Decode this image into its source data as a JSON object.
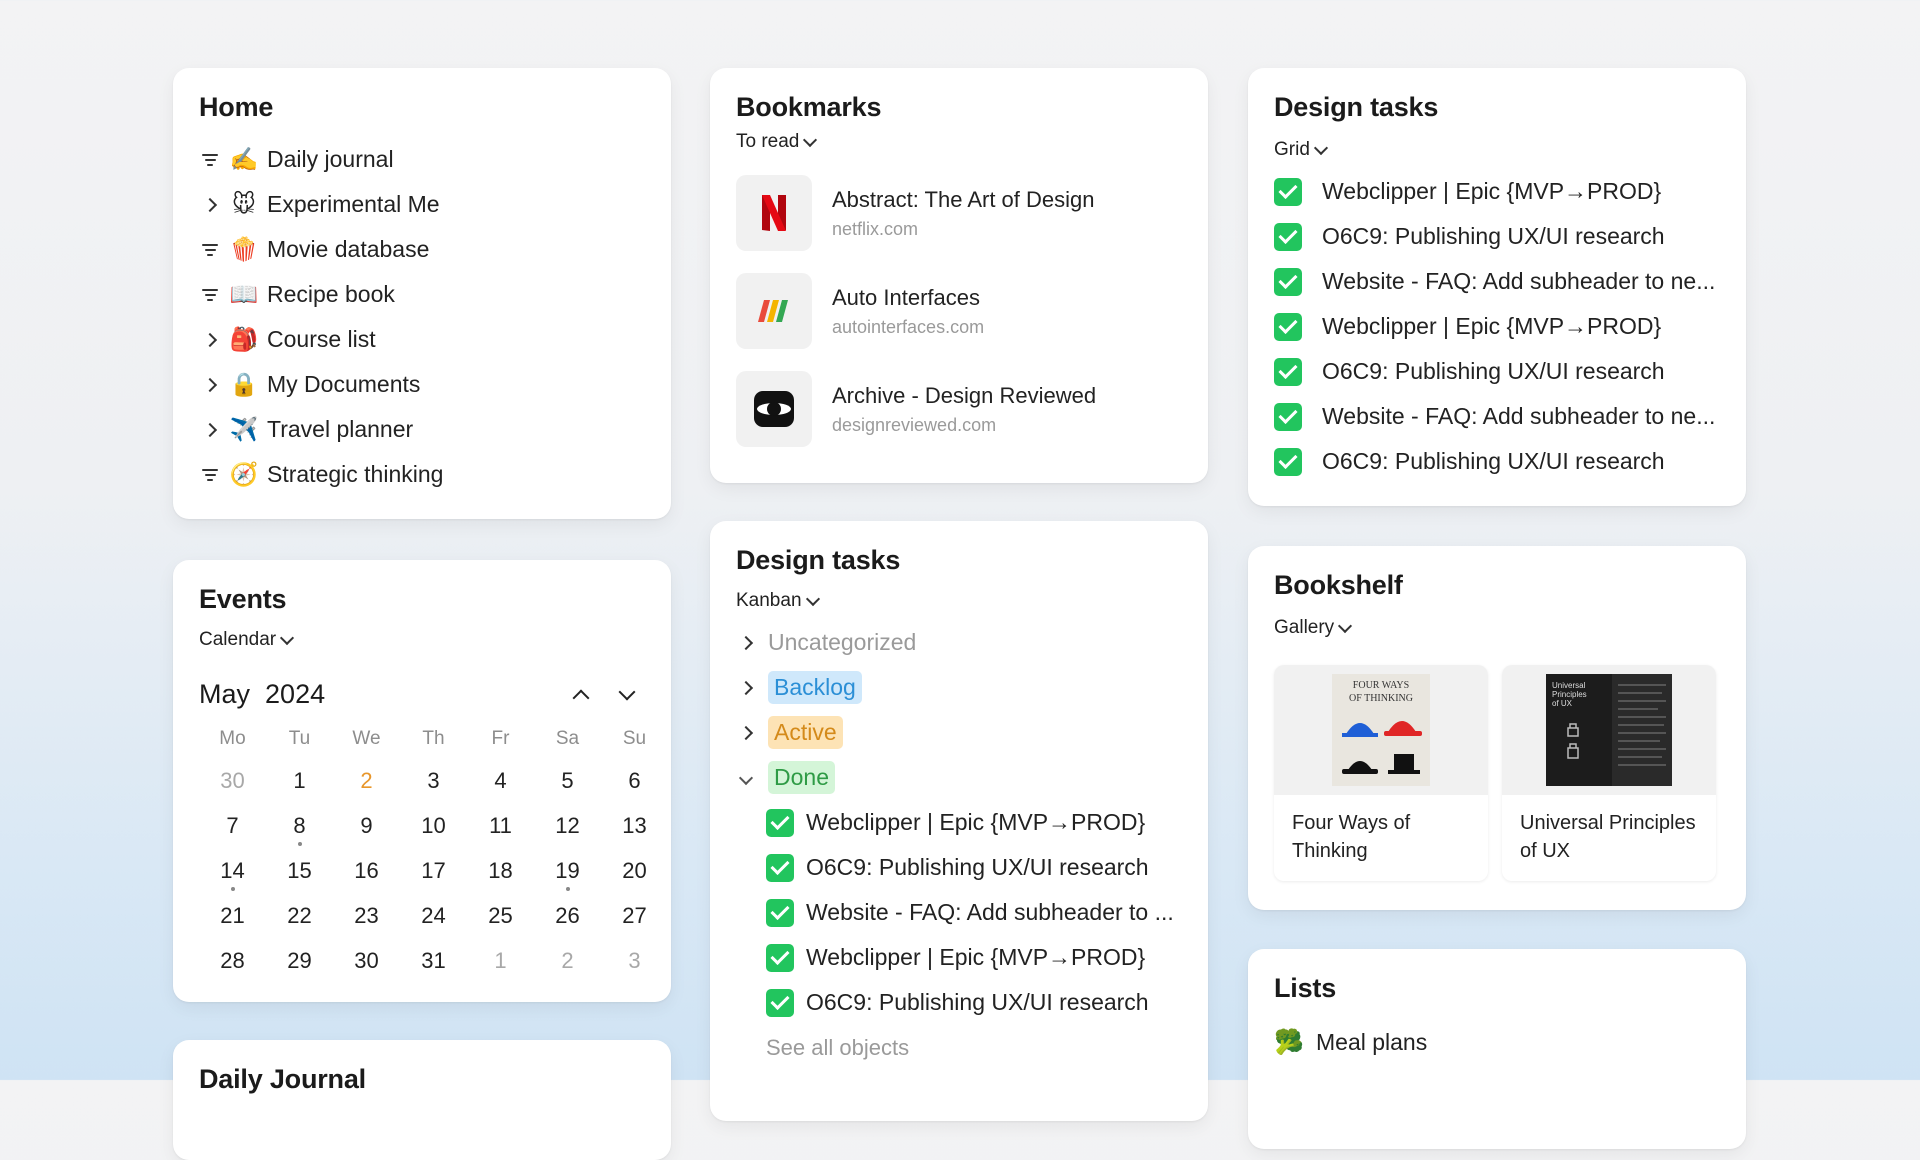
{
  "home": {
    "title": "Home",
    "items": [
      {
        "lead": "filter",
        "emoji": "✍️",
        "icon": "writing-hand-icon",
        "label": "Daily journal"
      },
      {
        "lead": "chevron",
        "emoji": "🐭",
        "icon": "mouse-icon",
        "label": "Experimental Me"
      },
      {
        "lead": "filter",
        "emoji": "🍿",
        "icon": "popcorn-icon",
        "label": "Movie database"
      },
      {
        "lead": "filter",
        "emoji": "📖",
        "icon": "book-icon",
        "label": "Recipe book"
      },
      {
        "lead": "chevron",
        "emoji": "🎒",
        "icon": "backpack-icon",
        "label": "Course list"
      },
      {
        "lead": "chevron",
        "emoji": "🔒",
        "icon": "lock-icon",
        "label": "My Documents"
      },
      {
        "lead": "chevron",
        "emoji": "✈️",
        "icon": "airplane-icon",
        "label": "Travel planner"
      },
      {
        "lead": "filter",
        "emoji": "🧭",
        "icon": "compass-icon",
        "label": "Strategic thinking"
      }
    ]
  },
  "bookmarks": {
    "title": "Bookmarks",
    "view": "To read",
    "items": [
      {
        "title": "Abstract: The Art of Design",
        "url": "netflix.com",
        "icon": "netflix-logo-icon"
      },
      {
        "title": "Auto Interfaces",
        "url": "autointerfaces.com",
        "icon": "auto-interfaces-logo-icon"
      },
      {
        "title": "Archive - Design Reviewed",
        "url": "designreviewed.com",
        "icon": "design-reviewed-logo-icon"
      }
    ]
  },
  "design_tasks_grid": {
    "title": "Design tasks",
    "view": "Grid",
    "tasks": [
      "Webclipper | Epic {MVP→PROD}",
      "O6C9: Publishing UX/UI research",
      "Website - FAQ: Add subheader to ne...",
      "Webclipper | Epic {MVP→PROD}",
      "O6C9: Publishing UX/UI research",
      "Website - FAQ: Add subheader to ne...",
      "O6C9: Publishing UX/UI research"
    ]
  },
  "events": {
    "title": "Events",
    "view": "Calendar",
    "month": "May",
    "year": "2024",
    "weekdays": [
      "Mo",
      "Tu",
      "We",
      "Th",
      "Fr",
      "Sa",
      "Su"
    ],
    "days": [
      {
        "d": "30",
        "muted": true
      },
      {
        "d": "1"
      },
      {
        "d": "2",
        "today": true
      },
      {
        "d": "3"
      },
      {
        "d": "4"
      },
      {
        "d": "5"
      },
      {
        "d": "6"
      },
      {
        "d": "7"
      },
      {
        "d": "8",
        "dot": true
      },
      {
        "d": "9"
      },
      {
        "d": "10"
      },
      {
        "d": "11"
      },
      {
        "d": "12"
      },
      {
        "d": "13"
      },
      {
        "d": "14",
        "dot": true
      },
      {
        "d": "15"
      },
      {
        "d": "16"
      },
      {
        "d": "17"
      },
      {
        "d": "18"
      },
      {
        "d": "19",
        "dot": true
      },
      {
        "d": "20"
      },
      {
        "d": "21"
      },
      {
        "d": "22"
      },
      {
        "d": "23"
      },
      {
        "d": "24"
      },
      {
        "d": "25"
      },
      {
        "d": "26"
      },
      {
        "d": "27"
      },
      {
        "d": "28"
      },
      {
        "d": "29"
      },
      {
        "d": "30"
      },
      {
        "d": "31"
      },
      {
        "d": "1",
        "muted": true
      },
      {
        "d": "2",
        "muted": true
      },
      {
        "d": "3",
        "muted": true
      }
    ]
  },
  "design_tasks_kanban": {
    "title": "Design tasks",
    "view": "Kanban",
    "groups": [
      {
        "label": "Uncategorized",
        "expanded": false,
        "style": "none"
      },
      {
        "label": "Backlog",
        "expanded": false,
        "style": "blue"
      },
      {
        "label": "Active",
        "expanded": false,
        "style": "orange"
      },
      {
        "label": "Done",
        "expanded": true,
        "style": "green"
      }
    ],
    "done_tasks": [
      "Webclipper | Epic {MVP→PROD}",
      "O6C9: Publishing UX/UI research",
      "Website - FAQ: Add subheader to ...",
      "Webclipper | Epic {MVP→PROD}",
      "O6C9: Publishing UX/UI research"
    ],
    "see_all": "See all objects"
  },
  "bookshelf": {
    "title": "Bookshelf",
    "view": "Gallery",
    "books": [
      {
        "title": "Four Ways of Thinking",
        "cover_text": "FOUR WAYS OF THINKING"
      },
      {
        "title": "Universal Principles of UX",
        "cover_text": "Universal Principles of UX"
      }
    ]
  },
  "lists": {
    "title": "Lists",
    "items": [
      {
        "emoji": "🥦",
        "icon": "broccoli-icon",
        "label": "Meal plans"
      }
    ]
  },
  "daily_journal": {
    "title": "Daily Journal"
  },
  "colors": {
    "check_green": "#22c55e",
    "backlog_bg": "#cfe8fb",
    "backlog_fg": "#2b8fd6",
    "active_bg": "#fde3b5",
    "active_fg": "#d48a1a",
    "done_bg": "#d4f5d8",
    "done_fg": "#2e9b45",
    "today": "#e8962a"
  }
}
